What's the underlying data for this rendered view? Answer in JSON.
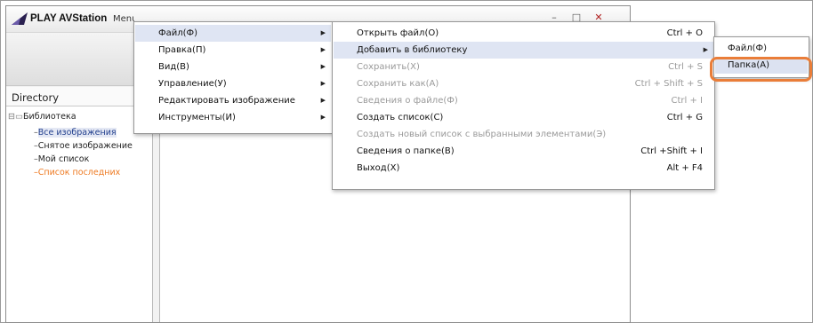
{
  "app": {
    "title": "PLAY AVStation",
    "menu_label": "Menu",
    "window_controls": [
      "–",
      "□",
      "✕"
    ]
  },
  "sidebar": {
    "title": "Directory",
    "root": "Библиотека",
    "items": [
      {
        "label": "Все изображения",
        "state": "selected"
      },
      {
        "label": "Снятое изображение",
        "state": "normal"
      },
      {
        "label": "Мой список",
        "state": "normal"
      },
      {
        "label": "Список последних",
        "state": "recent"
      }
    ]
  },
  "main_menu": {
    "items": [
      {
        "label": "Файл(Ф)"
      },
      {
        "label": "Правка(П)"
      },
      {
        "label": "Вид(В)"
      },
      {
        "label": "Управление(У)"
      },
      {
        "label": "Редактировать изображение"
      },
      {
        "label": "Инструменты(И)"
      }
    ]
  },
  "file_menu": {
    "items": [
      {
        "label": "Открыть файл(О)",
        "shortcut": "Ctrl + O"
      },
      {
        "label": "Добавить в библиотеку",
        "shortcut": ""
      },
      {
        "label": "Сохранить(Х)",
        "shortcut": "Ctrl + S"
      },
      {
        "label": "Сохранить как(А)",
        "shortcut": "Ctrl + Shift + S"
      },
      {
        "label": "Сведения о файле(Ф)",
        "shortcut": "Ctrl + I"
      },
      {
        "label": "Создать список(С)",
        "shortcut": "Ctrl + G"
      },
      {
        "label": "Создать новый список с выбранными элементами(Э)",
        "shortcut": ""
      },
      {
        "label": "Сведения о папке(В)",
        "shortcut": "Ctrl +Shift + I"
      },
      {
        "label": "Выход(Х)",
        "shortcut": "Alt + F4"
      }
    ]
  },
  "library_menu": {
    "items": [
      {
        "label": "Файл(Ф)"
      },
      {
        "label": "Папка(А)"
      }
    ]
  },
  "colors": {
    "highlight_ring": "#ea7d38",
    "menu_hover": "#dfe5f3",
    "recent_text": "#ee7a22",
    "selected_text": "#23408e",
    "disabled_text": "#9a9a9a"
  },
  "icons": {
    "app_logo": "playmemories-logo-icon",
    "submenu_arrow": "chevron-right-icon",
    "library_root": "library-tree-icon"
  }
}
